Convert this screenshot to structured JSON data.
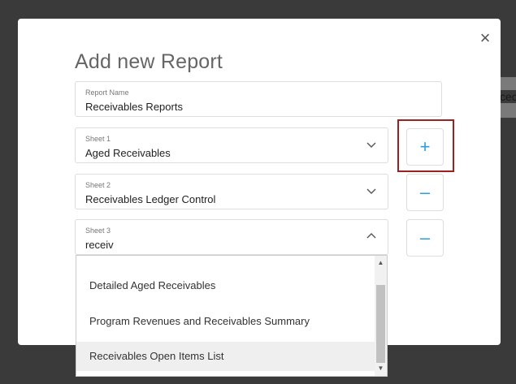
{
  "background": {
    "partial_text": "cec"
  },
  "modal": {
    "title": "Add new Report",
    "report_name": {
      "label": "Report Name",
      "value": "Receivables Reports"
    },
    "sheets": [
      {
        "label": "Sheet 1",
        "value": "Aged Receivables",
        "button": "+"
      },
      {
        "label": "Sheet 2",
        "value": "Receivables Ledger Control",
        "button": "–"
      },
      {
        "label": "Sheet 3",
        "value": "receiv",
        "button": "–"
      }
    ],
    "dropdown_options": [
      "Detailed Aged Receivables",
      "Program Revenues and Receivables Summary",
      "Receivables Open Items List"
    ],
    "close_symbol": "×"
  },
  "colors": {
    "accent": "#2aa0d8",
    "highlight_border": "#a02020"
  },
  "icons": {
    "close": "close-icon",
    "chevron_down": "chevron-down-icon",
    "chevron_up": "chevron-up-icon"
  }
}
